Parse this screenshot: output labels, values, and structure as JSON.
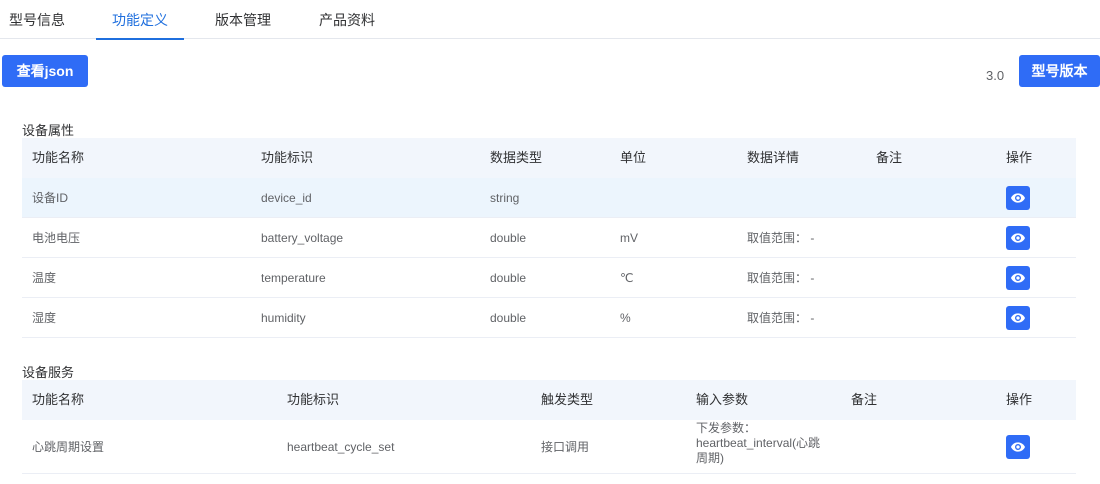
{
  "tabs": [
    {
      "label": "型号信息"
    },
    {
      "label": "功能定义"
    },
    {
      "label": "版本管理"
    },
    {
      "label": "产品资料"
    }
  ],
  "toolbar": {
    "view_json_label": "查看json",
    "version_value": "3.0",
    "model_version_label": "型号版本"
  },
  "properties": {
    "title": "设备属性",
    "headers": {
      "name": "功能名称",
      "identifier": "功能标识",
      "data_type": "数据类型",
      "unit": "单位",
      "data_detail": "数据详情",
      "remark": "备注",
      "action": "操作"
    },
    "rows": [
      {
        "name": "设备ID",
        "identifier": "device_id",
        "data_type": "string",
        "unit": "",
        "data_detail": "",
        "remark": ""
      },
      {
        "name": "电池电压",
        "identifier": "battery_voltage",
        "data_type": "double",
        "unit": "mV",
        "data_detail": "取值范围： -",
        "remark": ""
      },
      {
        "name": "温度",
        "identifier": "temperature",
        "data_type": "double",
        "unit": "℃",
        "data_detail": "取值范围： -",
        "remark": ""
      },
      {
        "name": "湿度",
        "identifier": "humidity",
        "data_type": "double",
        "unit": "%",
        "data_detail": "取值范围： -",
        "remark": ""
      }
    ]
  },
  "services": {
    "title": "设备服务",
    "headers": {
      "name": "功能名称",
      "identifier": "功能标识",
      "trigger_type": "触发类型",
      "input_params": "输入参数",
      "remark": "备注",
      "action": "操作"
    },
    "rows": [
      {
        "name": "心跳周期设置",
        "identifier": "heartbeat_cycle_set",
        "trigger_type": "接口调用",
        "input_params": [
          "下发参数：",
          "heartbeat_interval(心跳",
          "周期)"
        ],
        "remark": ""
      }
    ]
  },
  "colors": {
    "primary": "#2f6cf6",
    "tab_active": "#1f6fde",
    "header_bg": "#f2f6fc",
    "row_highlight": "#ecf5fd"
  }
}
